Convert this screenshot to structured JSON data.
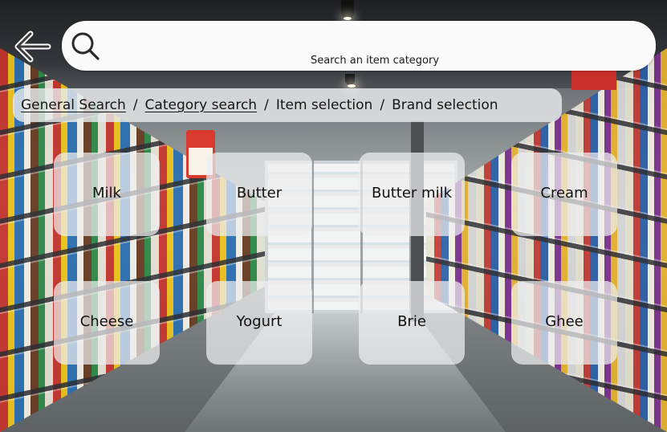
{
  "navigation": {
    "back_icon": "arrow-left-icon"
  },
  "search": {
    "icon": "search-icon",
    "placeholder": "Search an item category",
    "value": ""
  },
  "breadcrumb": {
    "items": [
      {
        "label": "General Search",
        "link": true
      },
      {
        "label": "Category search",
        "link": true
      },
      {
        "label": "Item selection",
        "link": false
      },
      {
        "label": "Brand selection",
        "link": false
      }
    ],
    "separator": "/"
  },
  "categories": [
    {
      "label": "Milk"
    },
    {
      "label": "Butter"
    },
    {
      "label": "Butter milk"
    },
    {
      "label": "Cream"
    },
    {
      "label": "Cheese"
    },
    {
      "label": "Yogurt"
    },
    {
      "label": "Brie"
    },
    {
      "label": "Ghee"
    }
  ],
  "colors": {
    "search_bar_bg": "#fbfbfb",
    "tile_bg": "#eeeef0",
    "text": "#111111"
  }
}
